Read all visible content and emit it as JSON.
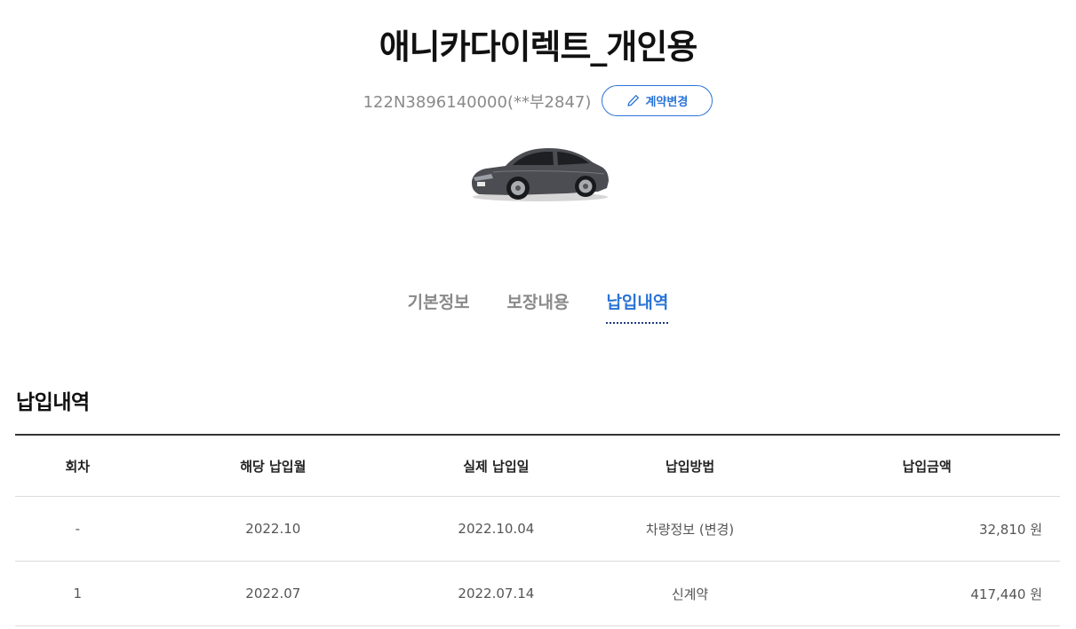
{
  "header": {
    "product_title": "애니카다이렉트_개인용",
    "contract_number": "122N3896140000(**부2847)",
    "change_button_label": "계약변경"
  },
  "tabs": [
    {
      "label": "기본정보",
      "active": false
    },
    {
      "label": "보장내용",
      "active": false
    },
    {
      "label": "납입내역",
      "active": true
    }
  ],
  "section": {
    "title": "납입내역"
  },
  "payment_table": {
    "columns": [
      "회차",
      "해당 납입월",
      "실제 납입일",
      "납입방법",
      "납입금액"
    ],
    "rows": [
      [
        "-",
        "2022.10",
        "2022.10.04",
        "차량정보 (변경)",
        "32,810 원"
      ],
      [
        "1",
        "2022.07",
        "2022.07.14",
        "신계약",
        "417,440 원"
      ]
    ]
  },
  "colors": {
    "accent": "#2a74d6",
    "muted_text": "#8a8a8a"
  },
  "icons": {
    "change_button": "pencil-icon"
  }
}
